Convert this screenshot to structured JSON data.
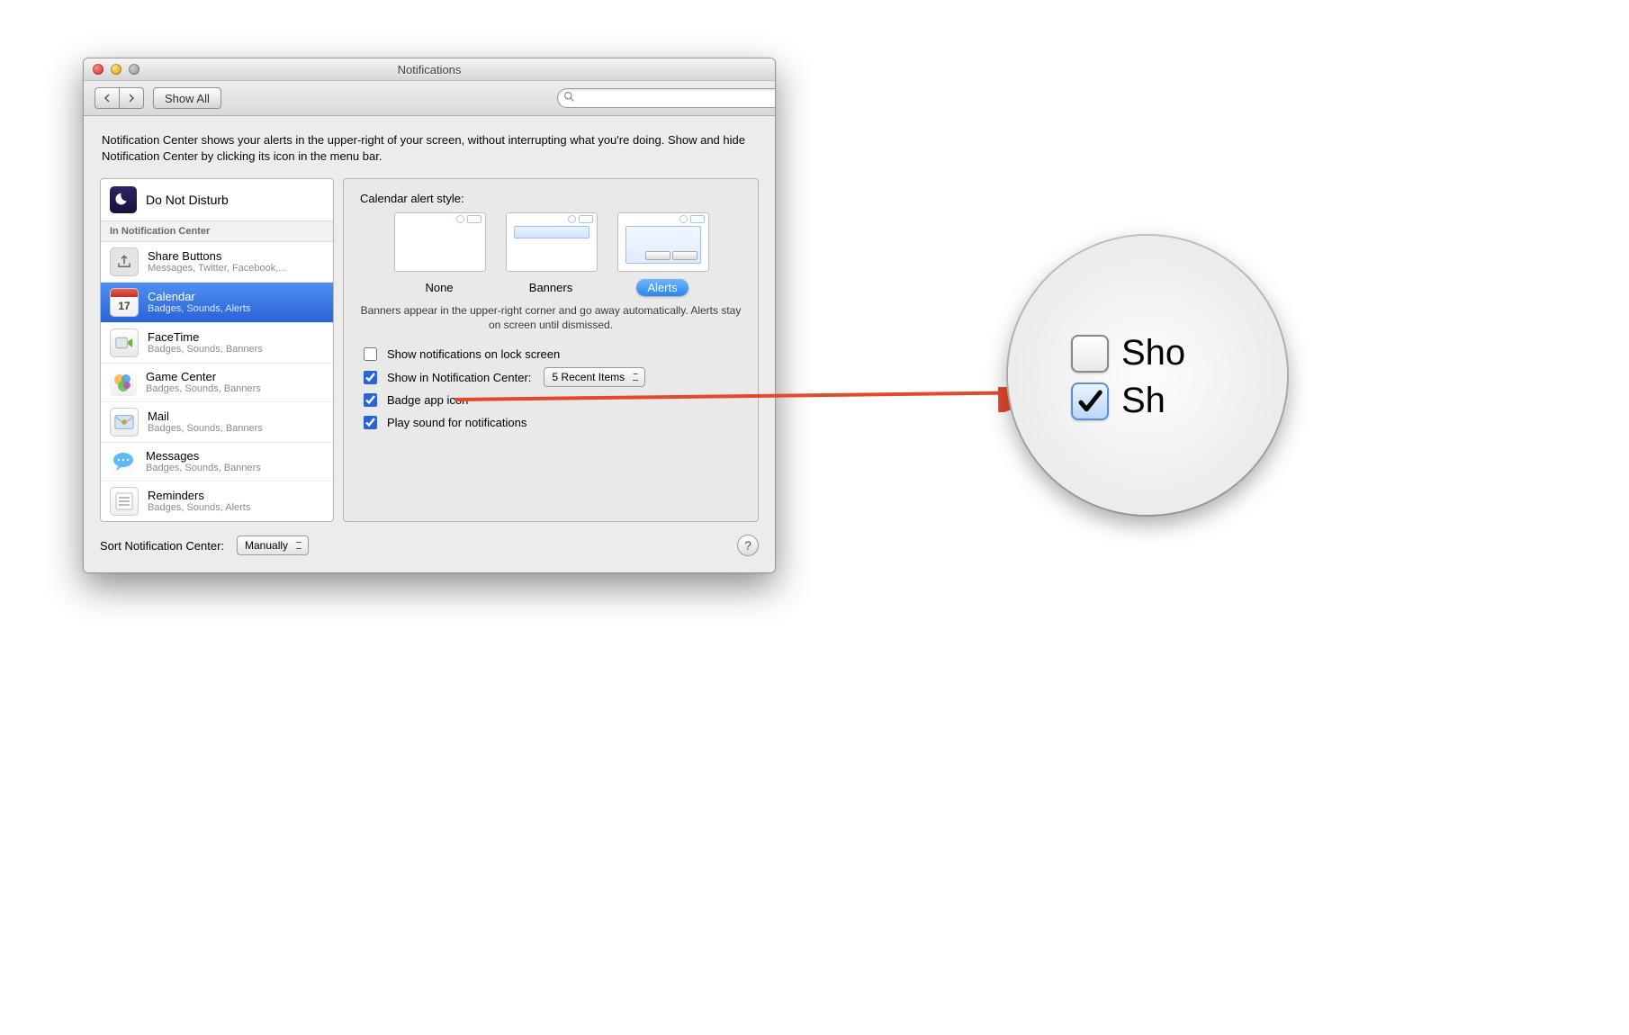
{
  "window": {
    "title": "Notifications"
  },
  "toolbar": {
    "show_all_label": "Show All",
    "search_placeholder": ""
  },
  "intro": "Notification Center shows your alerts in the upper-right of your screen, without interrupting what you're doing. Show and hide Notification Center by clicking its icon in the menu bar.",
  "sidebar": {
    "dnd_label": "Do Not Disturb",
    "section_label": "In Notification Center",
    "apps": [
      {
        "name": "Share Buttons",
        "sub": "Messages, Twitter, Facebook,...",
        "icon": "share-icon",
        "selected": false
      },
      {
        "name": "Calendar",
        "sub": "Badges, Sounds, Alerts",
        "icon": "calendar-icon",
        "selected": true
      },
      {
        "name": "FaceTime",
        "sub": "Badges, Sounds, Banners",
        "icon": "facetime-icon",
        "selected": false
      },
      {
        "name": "Game Center",
        "sub": "Badges, Sounds, Banners",
        "icon": "gamecenter-icon",
        "selected": false
      },
      {
        "name": "Mail",
        "sub": "Badges, Sounds, Banners",
        "icon": "mail-icon",
        "selected": false
      },
      {
        "name": "Messages",
        "sub": "Badges, Sounds, Banners",
        "icon": "messages-icon",
        "selected": false
      },
      {
        "name": "Reminders",
        "sub": "Badges, Sounds, Alerts",
        "icon": "reminders-icon",
        "selected": false
      }
    ]
  },
  "detail": {
    "heading": "Calendar alert style:",
    "styles": {
      "none": "None",
      "banners": "Banners",
      "alerts": "Alerts",
      "selected": "alerts"
    },
    "hint": "Banners appear in the upper-right corner and go away automatically. Alerts stay on screen until dismissed.",
    "opt_lock": {
      "label": "Show notifications on lock screen",
      "checked": false
    },
    "opt_nc": {
      "label": "Show in Notification Center:",
      "checked": true,
      "dropdown": "5 Recent Items"
    },
    "opt_badge": {
      "label": "Badge app icon",
      "checked": true
    },
    "opt_sound": {
      "label": "Play sound for notifications",
      "checked": true
    }
  },
  "footer": {
    "sort_label": "Sort Notification Center:",
    "sort_value": "Manually"
  },
  "zoom": {
    "row1": "Sho",
    "row2": "Sh"
  }
}
